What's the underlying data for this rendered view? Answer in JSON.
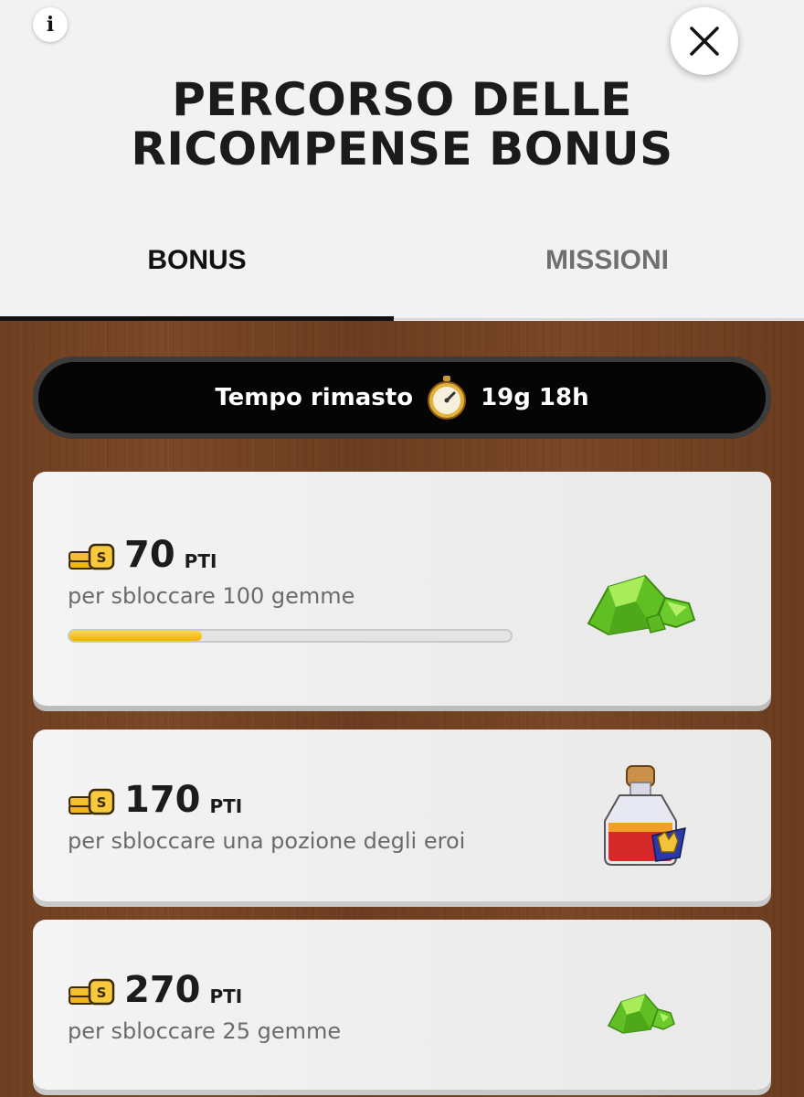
{
  "header": {
    "title": "PERCORSO DELLE RICOMPENSE BONUS",
    "info_icon": "info-icon",
    "close_icon": "close-icon"
  },
  "tabs": [
    {
      "label": "BONUS",
      "active": true
    },
    {
      "label": "MISSIONI",
      "active": false
    }
  ],
  "timer": {
    "label": "Tempo rimasto",
    "icon": "stopwatch-icon",
    "value": "19g 18h"
  },
  "rewards": [
    {
      "points": "70",
      "unit": "PTI",
      "description": "per sbloccare 100 gemme",
      "icon": "gems-icon",
      "progress": 0.3
    },
    {
      "points": "170",
      "unit": "PTI",
      "description": "per sbloccare una pozione degli eroi",
      "icon": "hero-potion-icon"
    },
    {
      "points": "270",
      "unit": "PTI",
      "description": "per sbloccare 25 gemme",
      "icon": "gems-icon"
    }
  ],
  "colors": {
    "progress_fill": "#f4b000",
    "wood": "#74432a",
    "gem": "#7cd33a"
  }
}
